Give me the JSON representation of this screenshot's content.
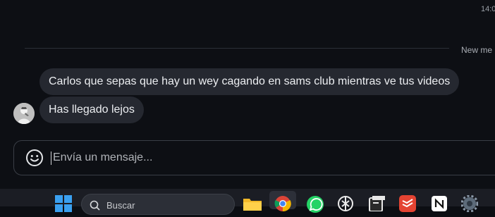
{
  "chat": {
    "time": "14:0",
    "new_messages_label": "New me",
    "messages": [
      {
        "text": "Carlos que sepas que hay un wey cagando en sams club mientras ve tus videos"
      },
      {
        "text": "Has llegado lejos"
      }
    ]
  },
  "composer": {
    "placeholder": "Envía un mensaje..."
  },
  "taskbar": {
    "search_label": "Buscar",
    "icons": [
      "windows-start-icon",
      "search-icon",
      "file-explorer-icon",
      "chrome-icon",
      "whatsapp-icon",
      "chatgpt-icon",
      "notes-app-icon",
      "todoist-icon",
      "notion-icon",
      "settings-icon"
    ]
  },
  "colors": {
    "background": "#0d0f14",
    "bubble": "#252830",
    "taskbar": "#1b1d24"
  }
}
